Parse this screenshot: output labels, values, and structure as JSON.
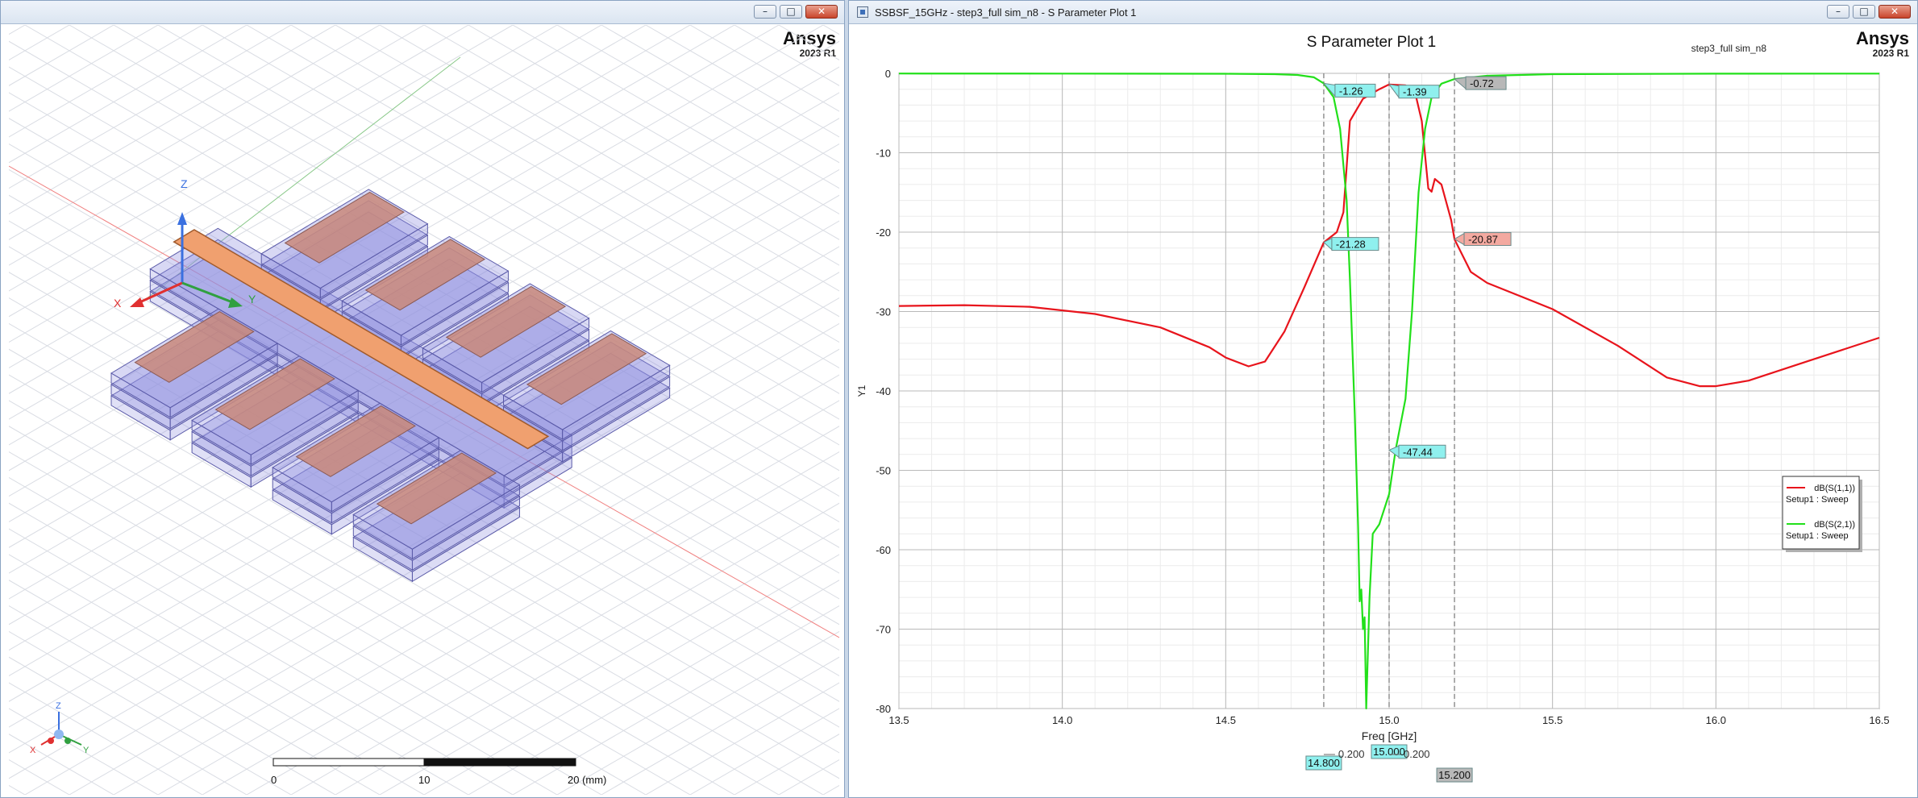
{
  "left_window": {
    "brand": "Ansys",
    "version": "2023 R1",
    "axes": {
      "x": "X",
      "y": "Y",
      "z": "Z"
    },
    "scale_bar": {
      "ticks": [
        "0",
        "10",
        "20 (mm)"
      ]
    }
  },
  "right_window": {
    "title": "SSBSF_15GHz - step3_full sim_n8 - S Parameter Plot 1",
    "brand": "Ansys",
    "version": "2023 R1",
    "project_label": "step3_full sim_n8"
  },
  "colors": {
    "s11": "#e8141c",
    "s21": "#22e01a",
    "marker_cyan": "#8ff0ee",
    "marker_red": "#f3a9a0",
    "marker_gray": "#b8b8b8",
    "substrate": "#8f8fe0",
    "strip": "#f0a06f"
  },
  "chart_data": {
    "type": "line",
    "title": "S Parameter Plot 1",
    "xlabel": "Freq [GHz]",
    "ylabel": "Y1",
    "xlim": [
      13.5,
      16.5
    ],
    "ylim": [
      -80,
      0
    ],
    "x_ticks": [
      13.5,
      14.0,
      14.5,
      15.0,
      15.5,
      16.0,
      16.5
    ],
    "y_ticks": [
      0,
      -10,
      -20,
      -30,
      -40,
      -50,
      -60,
      -70,
      -80
    ],
    "grid": true,
    "legend_position": "right",
    "series": [
      {
        "name": "dB(S(1,1))",
        "setup": "Setup1 : Sweep",
        "points": [
          [
            13.5,
            -29.3
          ],
          [
            13.7,
            -29.2
          ],
          [
            13.9,
            -29.4
          ],
          [
            14.1,
            -30.3
          ],
          [
            14.3,
            -32.0
          ],
          [
            14.45,
            -34.5
          ],
          [
            14.5,
            -35.8
          ],
          [
            14.57,
            -36.9
          ],
          [
            14.62,
            -36.3
          ],
          [
            14.68,
            -32.5
          ],
          [
            14.74,
            -27.0
          ],
          [
            14.8,
            -21.3
          ],
          [
            14.84,
            -20.0
          ],
          [
            14.86,
            -17.5
          ],
          [
            14.88,
            -6.0
          ],
          [
            14.92,
            -3.2
          ],
          [
            14.97,
            -2.0
          ],
          [
            15.0,
            -1.4
          ],
          [
            15.05,
            -1.5
          ],
          [
            15.08,
            -2.5
          ],
          [
            15.1,
            -6.0
          ],
          [
            15.12,
            -14.5
          ],
          [
            15.13,
            -14.9
          ],
          [
            15.14,
            -13.3
          ],
          [
            15.16,
            -14.0
          ],
          [
            15.19,
            -18.5
          ],
          [
            15.2,
            -20.9
          ],
          [
            15.25,
            -25.0
          ],
          [
            15.3,
            -26.4
          ],
          [
            15.5,
            -29.7
          ],
          [
            15.7,
            -34.3
          ],
          [
            15.85,
            -38.3
          ],
          [
            15.95,
            -39.4
          ],
          [
            16.0,
            -39.4
          ],
          [
            16.1,
            -38.7
          ],
          [
            16.3,
            -36.0
          ],
          [
            16.5,
            -33.3
          ]
        ]
      },
      {
        "name": "dB(S(2,1))",
        "setup": "Setup1 : Sweep",
        "points": [
          [
            13.5,
            -0.02
          ],
          [
            14.0,
            -0.03
          ],
          [
            14.5,
            -0.05
          ],
          [
            14.65,
            -0.1
          ],
          [
            14.72,
            -0.2
          ],
          [
            14.77,
            -0.5
          ],
          [
            14.8,
            -1.26
          ],
          [
            14.83,
            -3.0
          ],
          [
            14.85,
            -7.0
          ],
          [
            14.87,
            -16.0
          ],
          [
            14.88,
            -26.0
          ],
          [
            14.895,
            -43.0
          ],
          [
            14.905,
            -57.0
          ],
          [
            14.91,
            -66.5
          ],
          [
            14.915,
            -65.0
          ],
          [
            14.92,
            -70.0
          ],
          [
            14.925,
            -68.5
          ],
          [
            14.93,
            -80.0
          ],
          [
            14.94,
            -66.0
          ],
          [
            14.95,
            -58.0
          ],
          [
            14.97,
            -56.8
          ],
          [
            15.0,
            -53.0
          ],
          [
            15.02,
            -47.4
          ],
          [
            15.05,
            -41.0
          ],
          [
            15.07,
            -30.0
          ],
          [
            15.09,
            -15.0
          ],
          [
            15.11,
            -7.0
          ],
          [
            15.13,
            -3.0
          ],
          [
            15.16,
            -1.3
          ],
          [
            15.2,
            -0.72
          ],
          [
            15.3,
            -0.3
          ],
          [
            15.5,
            -0.1
          ],
          [
            16.0,
            -0.04
          ],
          [
            16.5,
            -0.03
          ]
        ]
      }
    ],
    "markers": [
      {
        "label": "-1.26",
        "x": 14.8,
        "y": -1.26,
        "series": "dB(S(2,1))",
        "style": "cyan"
      },
      {
        "label": "-1.39",
        "x": 15.0,
        "y": -1.39,
        "series": "dB(S(1,1))",
        "style": "cyan"
      },
      {
        "label": "-0.72",
        "x": 15.2,
        "y": -0.72,
        "series": "dB(S(2,1))",
        "style": "gray"
      },
      {
        "label": "-21.28",
        "x": 14.8,
        "y": -21.28,
        "series": "dB(S(1,1))",
        "style": "cyan"
      },
      {
        "label": "-20.87",
        "x": 15.2,
        "y": -20.87,
        "series": "dB(S(1,1))",
        "style": "red"
      },
      {
        "label": "-47.44",
        "x": 15.0,
        "y": -47.44,
        "series": "dB(S(2,1))",
        "style": "cyan"
      }
    ],
    "cursors": [
      {
        "label": "14.800",
        "x": 14.8,
        "style": "cyan"
      },
      {
        "label": "15.000",
        "x": 15.0,
        "style": "cyan"
      },
      {
        "label": "15.200",
        "x": 15.2,
        "style": "gray"
      }
    ],
    "deltas": [
      {
        "label": "0.200",
        "from": 14.8,
        "to": 15.0
      },
      {
        "label": "0.200",
        "from": 15.0,
        "to": 15.2
      }
    ]
  }
}
